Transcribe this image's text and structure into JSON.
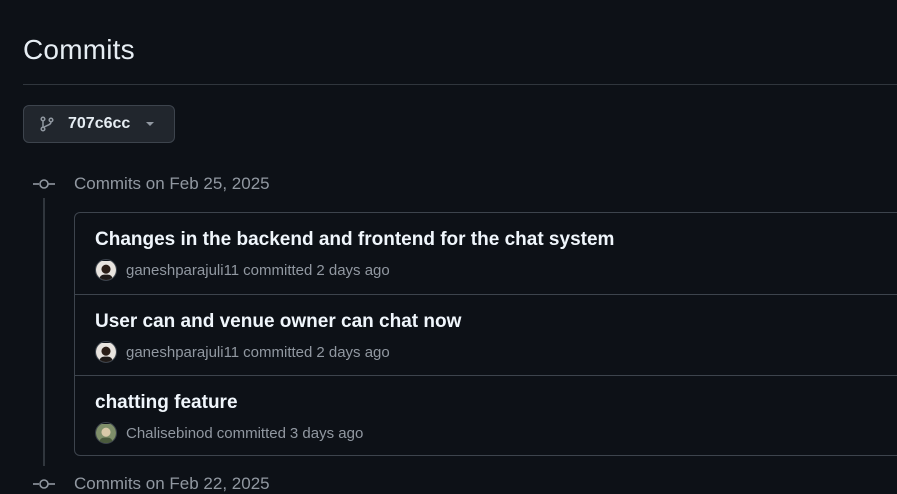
{
  "page": {
    "title": "Commits"
  },
  "branch": {
    "label": "707c6cc",
    "icon": "git-branch-icon"
  },
  "groups": [
    {
      "label": "Commits on Feb 25, 2025",
      "commits": [
        {
          "title": "Changes in the backend and frontend for the chat system",
          "author": "ganeshparajuli11",
          "action": "committed",
          "time": "2 days ago",
          "avatar": "avatar-dark-portrait"
        },
        {
          "title": "User can and venue owner can chat now",
          "author": "ganeshparajuli11",
          "action": "committed",
          "time": "2 days ago",
          "avatar": "avatar-dark-portrait"
        },
        {
          "title": "chatting feature",
          "author": "Chalisebinod",
          "action": "committed",
          "time": "3 days ago",
          "avatar": "avatar-green-portrait"
        }
      ]
    },
    {
      "label": "Commits on Feb 22, 2025"
    }
  ],
  "colors": {
    "background": "#0d1117",
    "border": "#3d444d",
    "muted": "#9198a1",
    "text": "#f0f6fc"
  }
}
